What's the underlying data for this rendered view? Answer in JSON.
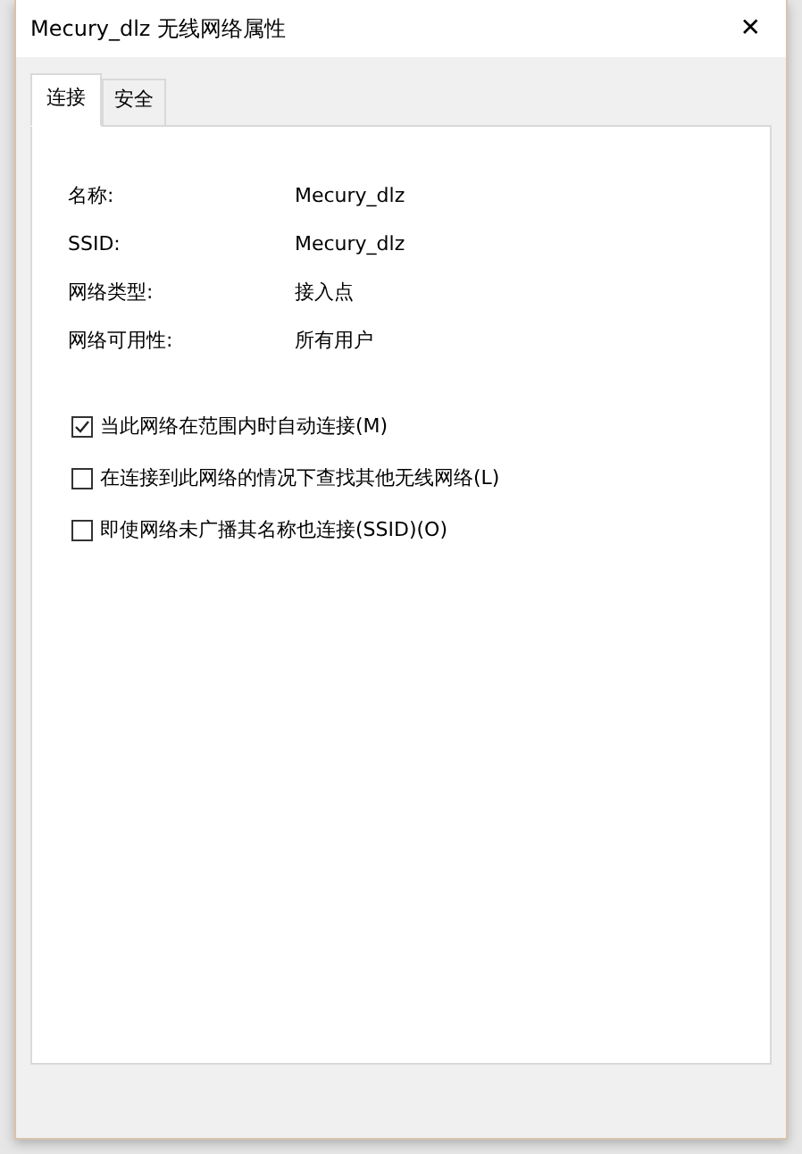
{
  "window": {
    "title": "Mecury_dlz 无线网络属性",
    "close": "✕"
  },
  "tabs": [
    {
      "label": "连接",
      "selected": true
    },
    {
      "label": "安全",
      "selected": false
    }
  ],
  "properties": [
    {
      "label": "名称:",
      "value": "Mecury_dlz"
    },
    {
      "label": "SSID:",
      "value": "Mecury_dlz"
    },
    {
      "label": "网络类型:",
      "value": "接入点"
    },
    {
      "label": "网络可用性:",
      "value": "所有用户"
    }
  ],
  "options": [
    {
      "label": "当此网络在范围内时自动连接(M)",
      "checked": true
    },
    {
      "label": "在连接到此网络的情况下查找其他无线网络(L)",
      "checked": false
    },
    {
      "label": "即使网络未广播其名称也连接(SSID)(O)",
      "checked": false
    }
  ]
}
